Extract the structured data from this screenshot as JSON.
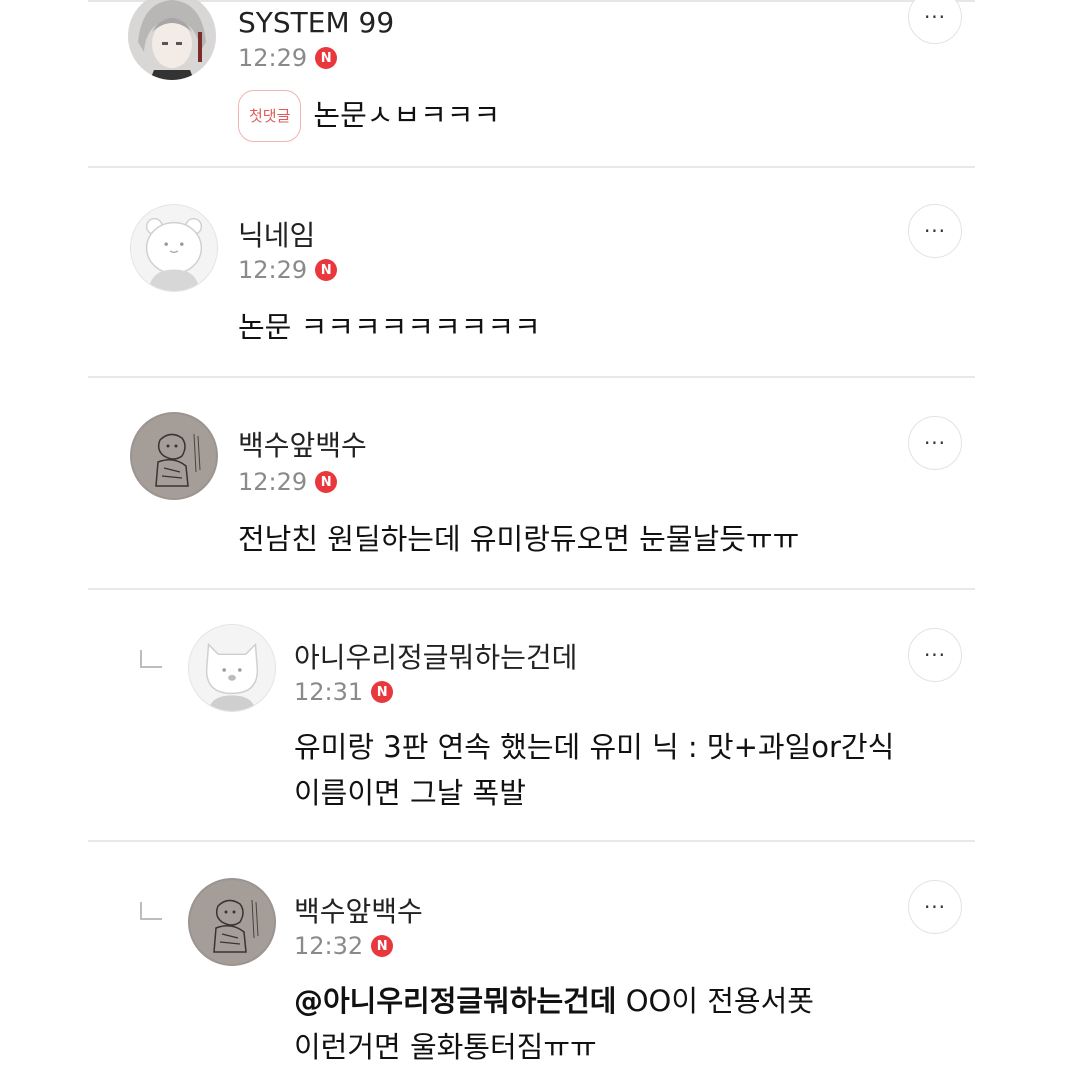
{
  "comments": [
    {
      "author": "SYSTEM 99",
      "time": "12:29",
      "new_badge": "N",
      "first_comment_badge": "첫댓글",
      "text": "논문ㅅㅂㅋㅋㅋ",
      "more_icon": "more-horizontal-icon",
      "avatar_icon": "anime-character-avatar"
    },
    {
      "author": "닉네임",
      "time": "12:29",
      "new_badge": "N",
      "text": "논문 ㅋㅋㅋㅋㅋㅋㅋㅋㅋ",
      "more_icon": "more-horizontal-icon",
      "avatar_icon": "default-bear-avatar"
    },
    {
      "author": "백수앞백수",
      "time": "12:29",
      "new_badge": "N",
      "text": "전남친 원딜하는데 유미랑듀오면 눈물날듯ㅠㅠ",
      "more_icon": "more-horizontal-icon",
      "avatar_icon": "sketch-drawing-avatar"
    },
    {
      "author": "아니우리정글뭐하는건데",
      "time": "12:31",
      "new_badge": "N",
      "text_line1": "유미랑 3판 연속 했는데 유미 닉 : 맛+과일or간식",
      "text_line2": "이름이면 그날 폭발",
      "more_icon": "more-horizontal-icon",
      "avatar_icon": "default-cat-avatar",
      "is_reply": true
    },
    {
      "author": "백수앞백수",
      "time": "12:32",
      "new_badge": "N",
      "mention": "@아니우리정글뭐하는건데",
      "text_line1_rest": " OO이 전용서폿",
      "text_line2": "이런거면 울화통터짐ㅠㅠ",
      "more_icon": "more-horizontal-icon",
      "avatar_icon": "sketch-drawing-avatar",
      "is_reply": true
    }
  ],
  "more_label": "···"
}
